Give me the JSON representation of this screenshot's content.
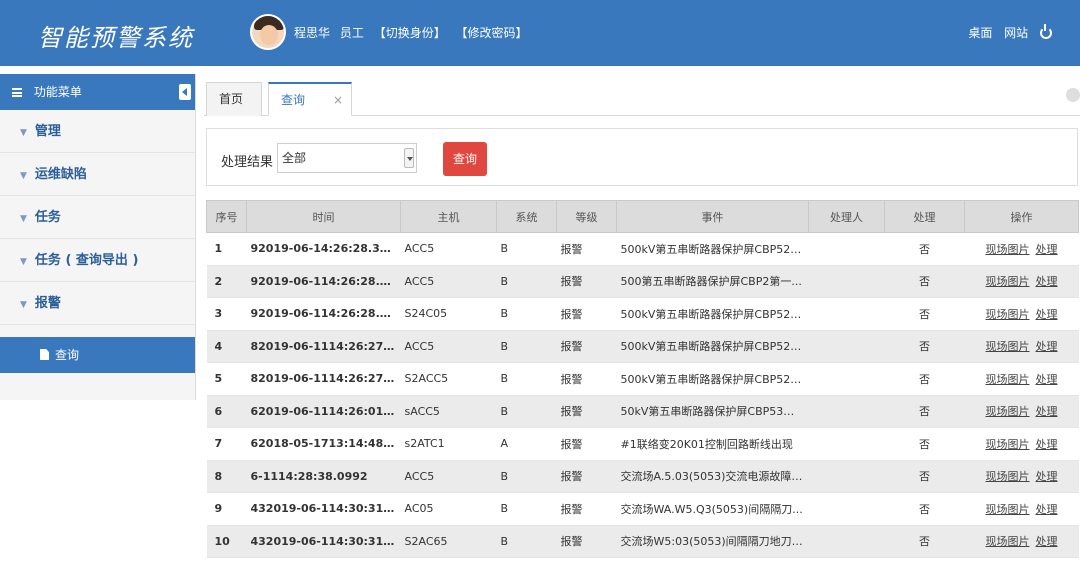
{
  "app": {
    "logo_text": "智能预警系统"
  },
  "header": {
    "user_name": "程思华",
    "role": "员工",
    "switch_identity": "【切换身份】",
    "change_password": "【修改密码】",
    "links": {
      "desktop": "桌面",
      "website": "网站"
    }
  },
  "sidebar": {
    "title": "功能菜单",
    "items": [
      {
        "label": "管理"
      },
      {
        "label": "运维缺陷"
      },
      {
        "label": "任务"
      },
      {
        "label": "任务 ( 查询导出 )"
      },
      {
        "label": "报警"
      }
    ],
    "sub_item": "查询"
  },
  "tabs": [
    {
      "label": "首页"
    },
    {
      "label": "查询",
      "close": "×"
    }
  ],
  "filter": {
    "label": "处理结果",
    "selected": "全部",
    "button": "查询"
  },
  "table": {
    "headers": [
      "序号",
      "时间",
      "主机",
      "系统",
      "等级",
      "事件",
      "处理人",
      "处理",
      "操作"
    ],
    "op_labels": {
      "photo": "现场图片",
      "handle": "处理"
    },
    "rows": [
      {
        "no": "1",
        "time": "92019-06-14:26:28.382...",
        "host": "ACC5",
        "sys": "B",
        "level": "报警",
        "event": "500kV第五串断路器保护屏CBP52第...",
        "handler": "",
        "handled": "否"
      },
      {
        "no": "2",
        "time": "92019-06-114:26:28.38...",
        "host": "ACC5",
        "sys": "B",
        "level": "报警",
        "event": "500第五串断路器保护屏CBP2第一...",
        "handler": "",
        "handled": "否"
      },
      {
        "no": "3",
        "time": "92019-06-114:26:28.382",
        "host": "S24C05",
        "sys": "B",
        "level": "报警",
        "event": "500kV第五串断路器保护屏CBP52第...",
        "handler": "",
        "handled": "否"
      },
      {
        "no": "4",
        "time": "82019-06-1114:26:27.9...",
        "host": "ACC5",
        "sys": "B",
        "level": "报警",
        "event": "500kV第五串断路器保护屏CBP52第...",
        "handler": "",
        "handled": "否"
      },
      {
        "no": "5",
        "time": "82019-06-1114:26:27.9...",
        "host": "S2ACC5",
        "sys": "B",
        "level": "报警",
        "event": "500kV第五串断路器保护屏CBP52第...",
        "handler": "",
        "handled": "否"
      },
      {
        "no": "6",
        "time": "62019-06-1114:26:01.7...",
        "host": "sACC5",
        "sys": "B",
        "level": "报警",
        "event": "50kV第五串断路器保护屏CBP53第...",
        "handler": "",
        "handled": "否"
      },
      {
        "no": "7",
        "time": "62018-05-1713:14:48.18",
        "host": "s2ATC1",
        "sys": "A",
        "level": "报警",
        "event": "#1联络变20K01控制回路断线出现",
        "handler": "",
        "handled": "否"
      },
      {
        "no": "8",
        "time": "6-1114:28:38.0992",
        "host": "ACC5",
        "sys": "B",
        "level": "报警",
        "event": "交流场A.5.03(5053)交流电源故障出...",
        "handler": "",
        "handled": "否"
      },
      {
        "no": "9",
        "time": "432019-06-114:30:31.7...",
        "host": "AC05",
        "sys": "B",
        "level": "报警",
        "event": "交流场WA.W5.Q3(5053)间隔隔刀...",
        "handler": "",
        "handled": "否"
      },
      {
        "no": "10",
        "time": "432019-06-114:30:31.7...",
        "host": "S2AC65",
        "sys": "B",
        "level": "报警",
        "event": "交流场W5:03(5053)间隔隔刀地刀电...",
        "handler": "",
        "handled": "否"
      }
    ]
  },
  "colors": {
    "primary": "#3a78bd",
    "danger": "#e0473f"
  },
  "icons": [
    "avatar",
    "power-icon",
    "menu-icon",
    "collapse-icon",
    "caret-down-icon",
    "document-icon",
    "close-icon",
    "select-arrow-icon"
  ]
}
